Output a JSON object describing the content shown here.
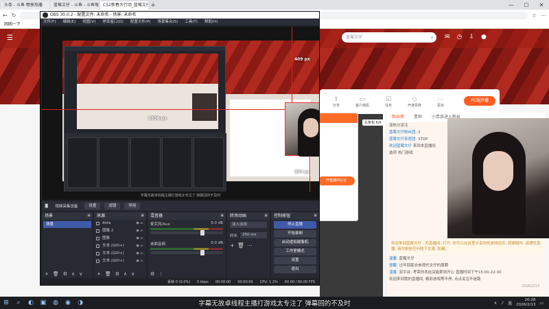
{
  "browser": {
    "tabs": [
      {
        "label": "头条 - 斗鱼 畅享热播"
      },
      {
        "label": "蓝莓文仔 - 斗鱼 - 斗鱼每周"
      },
      {
        "label": "CS2新春大行动_蓝莓文仔 - 斗鱼"
      }
    ],
    "new_tab_symbol": "+",
    "bookmark_label": "困困一下"
  },
  "page": {
    "search_placeholder": "蓝莓文仔",
    "tools": [
      {
        "label": "分享"
      },
      {
        "label": "客户端看"
      },
      {
        "label": "任务"
      },
      {
        "label": "开通贵族"
      },
      {
        "label": "更多"
      }
    ],
    "pc_live_label": "PC端开播",
    "side_badge": "头条包 6/6",
    "popup_button": "开直播间认证",
    "chat_tabs": [
      "粉丝榜",
      "贵宾",
      "小贵族进入粉丝"
    ],
    "chat_lines": [
      {
        "user": "",
        "text": "加热分享注"
      },
      {
        "user": "蓝莓文仔粉丝团:",
        "text": "2"
      },
      {
        "user": "蓝莓文仔亲密团:",
        "text": "STOP"
      },
      {
        "user": "欢迎蓝莓文仔",
        "text": "来到本直播间"
      },
      {
        "user": "",
        "text": "选项 热门游戏"
      }
    ],
    "notice": "欢迎来到蓝莓文仔 - 的直播间, 打开, 你可以在这里分享你的游戏经历, 感谢陪伴, 请理性直播, 请勿相信任何线下交易, 防骗。",
    "chat_tail": [
      {
        "user": "温馨:",
        "text": "蓝莓文仔"
      },
      {
        "user": "提醒:",
        "text": "过年回家去参观代文仔的周期"
      },
      {
        "user": "温馨:",
        "text": "双平台: 考荣你本此店能那则开心 直播时间下午15:00-22:00"
      },
      {
        "user": "",
        "text": "欢迎来到我的直播间, 精彩游戏等不停, 点点关注不迷路"
      }
    ],
    "clock": "2026/2/13"
  },
  "obs": {
    "title": "OBS 30.0.2 - 配置文件: 未命名 - 场景: 未命名",
    "menu": [
      "文件(F)",
      "编辑(E)",
      "视图(V)",
      "停靠窗口(D)",
      "配置文件(P)",
      "场景集合(S)",
      "工具(T)",
      "帮助(H)"
    ],
    "preview_dims": {
      "top_right": "409 px",
      "bottom_left": "1556 px",
      "bottom_right": "334 px"
    },
    "preview_caption": "字幕无故卓线程主播打游戏太专注了 弹幕回的不及时",
    "controls": {
      "device": "视频采集设备",
      "settings": "设置",
      "filters": "滤镜",
      "activate": "停用"
    },
    "docks": {
      "scenes": {
        "title": "场景",
        "items": [
          "场景"
        ]
      },
      "sources": {
        "title": "来源",
        "items": [
          "dota",
          "图像 2",
          "图像",
          "文本 (GDI+) 2",
          "文本 (GDI+)",
          "文本 (GDI+) 3"
        ]
      },
      "mixer": {
        "title": "混音器",
        "channels": [
          {
            "name": "麦克风/Aux",
            "db": "0.0 dB",
            "level": 0.72
          },
          {
            "name": "桌面音频",
            "db": "0.0 dB",
            "level": 0.72
          }
        ]
      },
      "transitions": {
        "title": "转场动画",
        "type": "淡入淡出",
        "duration_label": "时长",
        "duration": "250 ms"
      },
      "controls": {
        "title": "控制按钮",
        "buttons": [
          "停止直播",
          "开始录制",
          "启动虚拟摄像机",
          "工作室模式",
          "设置",
          "退出"
        ]
      }
    },
    "status": {
      "dropped": "丢帧 0 (0.0%)",
      "bitrate": "0 kbps",
      "live_time": "00:00:00",
      "rec_time": "00:00:00",
      "cpu": "CPU: 1.2%",
      "fps": "60.00 / 60.00 FPS"
    }
  },
  "taskbar": {
    "lang": "英",
    "time": "20:28",
    "date": "2026/2/13"
  },
  "colors": {
    "accent": "#ff5d23",
    "obs_primary": "#3f5aa8",
    "hero": "#b02a1f"
  }
}
